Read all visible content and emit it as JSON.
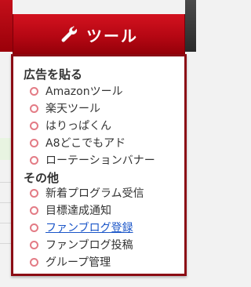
{
  "header": {
    "tab_label": "ツール",
    "tab_icon": "wrench-icon",
    "accent_color": "#b50713",
    "border_color": "#8b0b14"
  },
  "menu": {
    "sections": [
      {
        "title": "広告を貼る",
        "items": [
          {
            "label": "Amazonツール"
          },
          {
            "label": "楽天ツール"
          },
          {
            "label": "はりっぱくん"
          },
          {
            "label": "A8どこでもアド"
          },
          {
            "label": "ローテーションバナー"
          }
        ]
      },
      {
        "title": "その他",
        "items": [
          {
            "label": "新着プログラム受信"
          },
          {
            "label": "目標達成通知"
          },
          {
            "label": "ファンブログ登録",
            "state": "hover-link"
          },
          {
            "label": "ファンブログ投稿"
          },
          {
            "label": "グループ管理"
          }
        ]
      }
    ]
  }
}
